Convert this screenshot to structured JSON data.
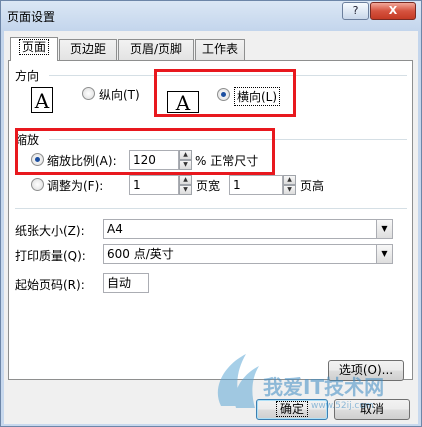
{
  "window": {
    "title": "页面设置",
    "help_label": "?",
    "close_label": "X"
  },
  "tabs": [
    {
      "label": "页面",
      "active": true
    },
    {
      "label": "页边距",
      "active": false
    },
    {
      "label": "页眉/页脚",
      "active": false
    },
    {
      "label": "工作表",
      "active": false
    }
  ],
  "orientation": {
    "heading": "方向",
    "portrait_label": "纵向(T)",
    "portrait_icon": "A",
    "landscape_label": "横向(L)",
    "landscape_icon": "A",
    "selected": "landscape"
  },
  "scaling": {
    "heading": "缩放",
    "adjust_label": "缩放比例(A):",
    "adjust_value": "120",
    "adjust_suffix": "% 正常尺寸",
    "fit_label": "调整为(F):",
    "fit_wide_value": "1",
    "fit_wide_suffix": "页宽",
    "fit_tall_value": "1",
    "fit_tall_suffix": "页高",
    "selected": "adjust"
  },
  "paper": {
    "paper_size_label": "纸张大小(Z):",
    "paper_size_value": "A4",
    "print_quality_label": "打印质量(Q):",
    "print_quality_value": "600 点/英寸",
    "first_page_label": "起始页码(R):",
    "first_page_value": "自动"
  },
  "buttons": {
    "options_label": "选项(O)...",
    "ok_label": "确定",
    "cancel_label": "取消"
  },
  "watermark": {
    "text": "我爱IT技术网",
    "subtext": "www.52ij.com"
  },
  "colors": {
    "highlight_box": "#e8181e",
    "radio_dot": "#1d4fa0"
  }
}
